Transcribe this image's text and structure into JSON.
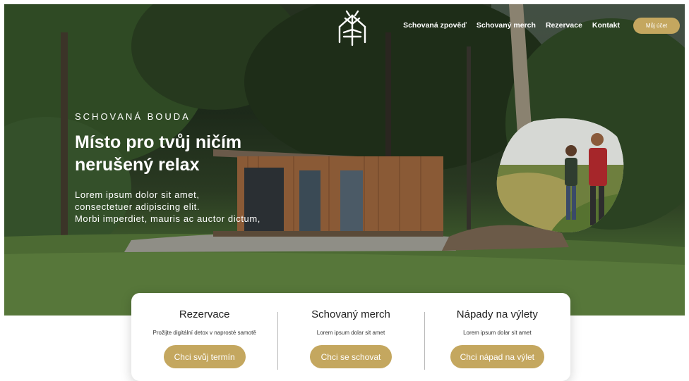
{
  "colors": {
    "accent": "#c4a75f",
    "text_light": "#ffffff",
    "text_dark": "#222222"
  },
  "header": {
    "logo": "house-tree-logo-icon",
    "nav": [
      "Schovaná zpověď",
      "Schovaný merch",
      "Rezervace",
      "Kontakt"
    ],
    "account_label": "Můj účet"
  },
  "hero": {
    "eyebrow": "SCHOVANÁ BOUDA",
    "headline_line1": "Místo pro tvůj ničím",
    "headline_line2": "nerušený relax",
    "lead_line1": "Lorem ipsum dolor sit amet,",
    "lead_line2": "consectetuer adipiscing elit.",
    "lead_line3": "Morbi imperdiet, mauris ac auctor dictum,"
  },
  "cards": [
    {
      "title": "Rezervace",
      "text": "Prožijte digitální detox v naprosté samotě",
      "button": "Chci svůj termín"
    },
    {
      "title": "Schovaný merch",
      "text": "Lorem ipsum dolar sit amet",
      "button": "Chci se schovat"
    },
    {
      "title": "Nápady na výlety",
      "text": "Lorem ipsum dolar sit amet",
      "button": "Chci nápad na výlet"
    }
  ]
}
